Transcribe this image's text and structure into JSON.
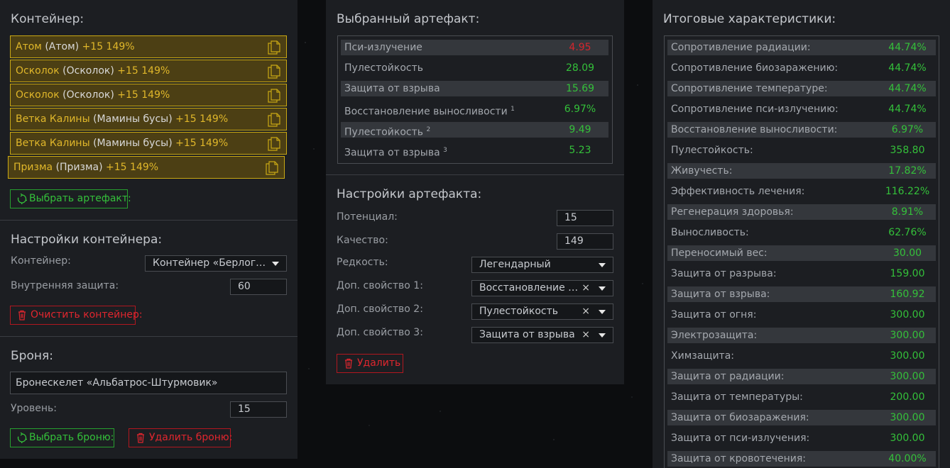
{
  "container": {
    "title": "Контейнер:",
    "items": [
      {
        "name": "Атом",
        "paren": "(Атом)",
        "level": "+15 149%"
      },
      {
        "name": "Осколок",
        "paren": "(Осколок)",
        "level": "+15 149%"
      },
      {
        "name": "Осколок",
        "paren": "(Осколок)",
        "level": "+15 149%"
      },
      {
        "name": "Ветка Калины",
        "paren": "(Мамины бусы)",
        "level": "+15 149%"
      },
      {
        "name": "Ветка Калины",
        "paren": "(Мамины бусы)",
        "level": "+15 149%"
      },
      {
        "name": "Призма",
        "paren": "(Призма)",
        "level": "+15 149%"
      }
    ],
    "select_artifact_label": "Выбрать артефакт:"
  },
  "container_settings": {
    "title": "Настройки контейнера:",
    "container_label": "Контейнер:",
    "container_value": "Контейнер «Берлога…",
    "inner_protection_label": "Внутренняя защита:",
    "inner_protection_value": "60",
    "clear_label": "Очистить контейнер:"
  },
  "armor": {
    "title": "Броня:",
    "name": "Бронескелет «Альбатрос-Штурмовик»",
    "level_label": "Уровень:",
    "level_value": "15",
    "select_label": "Выбрать броню:",
    "delete_label": "Удалить броню:"
  },
  "selected_artifact": {
    "title": "Выбранный артефакт:",
    "rows": [
      {
        "key": "Пси-излучение",
        "sup": "",
        "value": "4.95",
        "negative": true
      },
      {
        "key": "Пулестойкость",
        "sup": "",
        "value": "28.09",
        "negative": false
      },
      {
        "key": "Защита от взрыва",
        "sup": "",
        "value": "15.69",
        "negative": false
      },
      {
        "key": "Восстановление выносливости",
        "sup": "1",
        "value": "6.97%",
        "negative": false
      },
      {
        "key": "Пулестойкость",
        "sup": "2",
        "value": "9.49",
        "negative": false
      },
      {
        "key": "Защита от взрыва",
        "sup": "3",
        "value": "5.23",
        "negative": false
      }
    ]
  },
  "artifact_settings": {
    "title": "Настройки артефакта:",
    "potential_label": "Потенциал:",
    "potential_value": "15",
    "quality_label": "Качество:",
    "quality_value": "149",
    "rarity_label": "Редкость:",
    "rarity_value": "Легендарный",
    "extra1_label": "Доп. свойство 1:",
    "extra1_value": "Восстановление в…",
    "extra2_label": "Доп. свойство 2:",
    "extra2_value": "Пулестойкость",
    "extra3_label": "Доп. свойство 3:",
    "extra3_value": "Защита от взрыва",
    "clear_symbol": "×",
    "delete_label": "Удалить"
  },
  "totals": {
    "title": "Итоговые характеристики:",
    "rows": [
      {
        "key": "Сопротивление радиации:",
        "value": "44.74%"
      },
      {
        "key": "Сопротивление биозаражению:",
        "value": "44.74%"
      },
      {
        "key": "Сопротивление температуре:",
        "value": "44.74%"
      },
      {
        "key": "Сопротивление пси-излучению:",
        "value": "44.74%"
      },
      {
        "key": "Восстановление выносливости:",
        "value": "6.97%"
      },
      {
        "key": "Пулестойкость:",
        "value": "358.80"
      },
      {
        "key": "Живучесть:",
        "value": "17.82%"
      },
      {
        "key": "Эффективность лечения:",
        "value": "116.22%"
      },
      {
        "key": "Регенерация здоровья:",
        "value": "8.91%"
      },
      {
        "key": "Выносливость:",
        "value": "62.76%"
      },
      {
        "key": "Переносимый вес:",
        "value": "30.00"
      },
      {
        "key": "Защита от разрыва:",
        "value": "159.00"
      },
      {
        "key": "Защита от взрыва:",
        "value": "160.92"
      },
      {
        "key": "Защита от огня:",
        "value": "300.00"
      },
      {
        "key": "Электрозащита:",
        "value": "300.00"
      },
      {
        "key": "Химзащита:",
        "value": "300.00"
      },
      {
        "key": "Защита от радиации:",
        "value": "300.00"
      },
      {
        "key": "Защита от температуры:",
        "value": "200.00"
      },
      {
        "key": "Защита от биозаражения:",
        "value": "300.00"
      },
      {
        "key": "Защита от пси-излучения:",
        "value": "300.00"
      },
      {
        "key": "Защита от кровотечения:",
        "value": "40.00%"
      }
    ]
  },
  "colors": {
    "accent_green": "#34c03a",
    "danger_red": "#e0262e",
    "container_gold": "#e0b72a"
  }
}
